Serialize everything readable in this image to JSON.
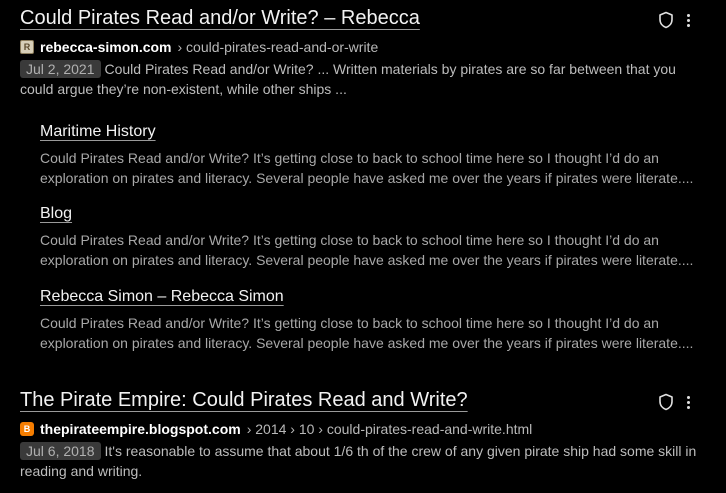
{
  "results": [
    {
      "title": "Could Pirates Read and/or Write? – Rebecca",
      "domain": "rebecca-simon.com",
      "path": "› could-pirates-read-and-or-write",
      "date": "Jul 2, 2021",
      "snippet": "Could Pirates Read and/or Write? ... Written materials by pirates are so far between that you could argue they’re non-existent, while other ships ...",
      "sitelinks": [
        {
          "title": "Maritime History",
          "desc": "Could Pirates Read and/or Write? It’s getting close to back to school time here so I thought I’d do an exploration on pirates and literacy. Several people have asked me over the years if pirates were literate...."
        },
        {
          "title": "Blog",
          "desc": "Could Pirates Read and/or Write? It’s getting close to back to school time here so I thought I’d do an exploration on pirates and literacy. Several people have asked me over the years if pirates were literate...."
        },
        {
          "title": "Rebecca Simon – Rebecca Simon",
          "desc": "Could Pirates Read and/or Write? It’s getting close to back to school time here so I thought I’d do an exploration on pirates and literacy. Several people have asked me over the years if pirates were literate...."
        }
      ]
    },
    {
      "title": "The Pirate Empire: Could Pirates Read and Write?",
      "domain": "thepirateempire.blogspot.com",
      "path": "› 2014 › 10 › could-pirates-read-and-write.html",
      "date": "Jul 6, 2018",
      "snippet": "It's reasonable to assume that about 1/6 th of the crew of any given pirate ship had some skill in reading and writing."
    }
  ],
  "colors": {
    "background": "#000000",
    "title": "#f2f2f2",
    "snippet": "#bdbdbd",
    "date_badge_bg": "#3a3a3a",
    "blogger_orange": "#f57d00"
  }
}
